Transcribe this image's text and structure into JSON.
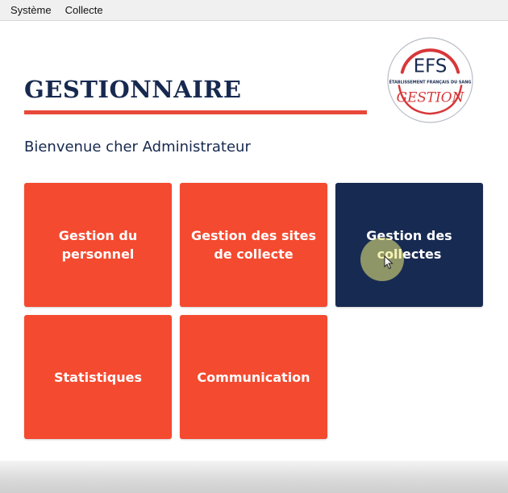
{
  "menu": {
    "items": [
      {
        "label": "Système"
      },
      {
        "label": "Collecte"
      }
    ]
  },
  "logo": {
    "top_text": "EFS",
    "subtitle": "ÉTABLISSEMENT FRANÇAIS DU SANG",
    "bottom_text": "GESTION",
    "colors": {
      "navy": "#17294f",
      "red": "#d7373a"
    }
  },
  "header": {
    "title": "GESTIONNAIRE",
    "welcome": "Bienvenue cher Administrateur"
  },
  "tiles": [
    {
      "line1": "Gestion du",
      "line2": "personnel",
      "color": "#f44a30"
    },
    {
      "line1": "Gestion des sites",
      "line2": "de collecte",
      "color": "#f44a30"
    },
    {
      "line1": "Gestion des",
      "line2": "collectes",
      "color": "#172a52",
      "state": "hovered"
    },
    {
      "line1": "Statistiques",
      "color": "#f44a30"
    },
    {
      "line1": "Communication",
      "color": "#f44a30"
    }
  ],
  "theme": {
    "accent": "#e8483a",
    "tile_orange": "#f44a30",
    "tile_navy": "#172a52",
    "text_navy": "#17294f"
  }
}
